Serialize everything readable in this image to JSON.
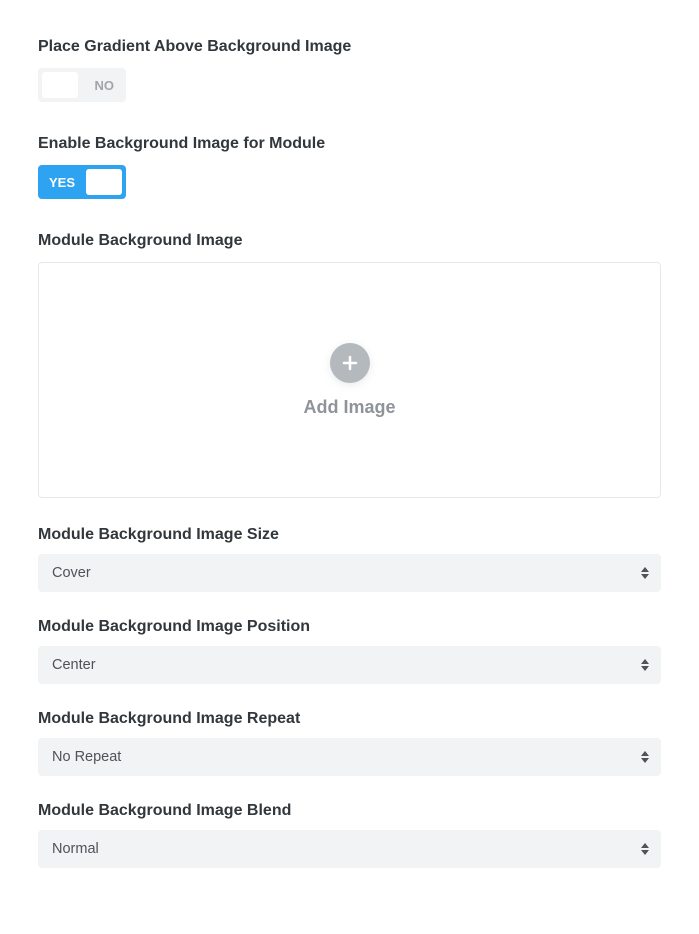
{
  "gradient_above": {
    "label": "Place Gradient Above Background Image",
    "value": "NO",
    "enabled": false
  },
  "enable_bg": {
    "label": "Enable Background Image for Module",
    "value": "YES",
    "enabled": true
  },
  "bg_image": {
    "label": "Module Background Image",
    "add_text": "Add Image"
  },
  "bg_size": {
    "label": "Module Background Image Size",
    "value": "Cover"
  },
  "bg_position": {
    "label": "Module Background Image Position",
    "value": "Center"
  },
  "bg_repeat": {
    "label": "Module Background Image Repeat",
    "value": "No Repeat"
  },
  "bg_blend": {
    "label": "Module Background Image Blend",
    "value": "Normal"
  }
}
